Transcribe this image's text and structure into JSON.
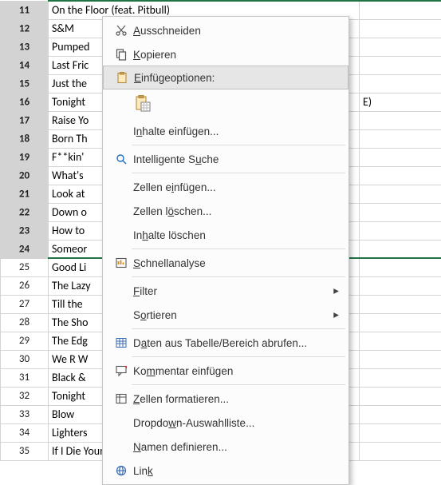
{
  "rows": [
    {
      "num": 11,
      "b": "On the Floor (feat. Pitbull)",
      "c": "",
      "sel": true
    },
    {
      "num": 12,
      "b": "S&M",
      "c": "",
      "sel": true
    },
    {
      "num": 13,
      "b": "Pumped",
      "c": "",
      "sel": true
    },
    {
      "num": 14,
      "b": "Last Fric",
      "c": "",
      "sel": true
    },
    {
      "num": 15,
      "b": "Just the",
      "c": "",
      "sel": true
    },
    {
      "num": 16,
      "b": "Tonight",
      "c": "E)",
      "sel": true
    },
    {
      "num": 17,
      "b": "Raise Yo",
      "c": "",
      "sel": true
    },
    {
      "num": 18,
      "b": "Born Th",
      "c": "",
      "sel": true
    },
    {
      "num": 19,
      "b": "F**kin' ",
      "c": "",
      "sel": true
    },
    {
      "num": 20,
      "b": "What's ",
      "c": "",
      "sel": true
    },
    {
      "num": 21,
      "b": "Look at",
      "c": "",
      "sel": true
    },
    {
      "num": 22,
      "b": "Down o",
      "c": "",
      "sel": true
    },
    {
      "num": 23,
      "b": "How to ",
      "c": "",
      "sel": true
    },
    {
      "num": 24,
      "b": "Someor",
      "c": "",
      "sel": true
    },
    {
      "num": 25,
      "b": "Good Li",
      "c": "",
      "sel": false
    },
    {
      "num": 26,
      "b": "The Lazy",
      "c": "",
      "sel": false
    },
    {
      "num": 27,
      "b": "Till the ",
      "c": "",
      "sel": false
    },
    {
      "num": 28,
      "b": "The Sho",
      "c": "",
      "sel": false
    },
    {
      "num": 29,
      "b": "The Edg",
      "c": "",
      "sel": false
    },
    {
      "num": 30,
      "b": "We R W",
      "c": "",
      "sel": false
    },
    {
      "num": 31,
      "b": "Black & ",
      "c": "",
      "sel": false
    },
    {
      "num": 32,
      "b": "Tonight",
      "c": "",
      "sel": false
    },
    {
      "num": 33,
      "b": "Blow",
      "c": "",
      "sel": false
    },
    {
      "num": 34,
      "b": "Lighters",
      "c": "",
      "sel": false
    },
    {
      "num": 35,
      "b": "If I Die Young",
      "c": "",
      "sel": false
    }
  ],
  "menu": {
    "cut": "Ausschneiden",
    "copy": "Kopieren",
    "pasteHeader": "Einfügeoptionen:",
    "pasteSpecial": "Inhalte einfügen...",
    "smartLookup": "Intelligente Suche",
    "insertCells": "Zellen einfügen...",
    "deleteCells": "Zellen löschen...",
    "clearContents": "Inhalte löschen",
    "quickAnalysis": "Schnellanalyse",
    "filter": "Filter",
    "sort": "Sortieren",
    "getData": "Daten aus Tabelle/Bereich abrufen...",
    "insertComment": "Kommentar einfügen",
    "formatCells": "Zellen formatieren...",
    "dropdown": "Dropdown-Auswahlliste...",
    "defineName": "Namen definieren...",
    "link": "Link"
  },
  "accel": {
    "cut": "A",
    "copy": "K",
    "pasteHeader": "E",
    "pasteSpecial": "n",
    "smartLookup": "u",
    "insertCells": "i",
    "deleteCells": "ö",
    "clearContents": "h",
    "quickAnalysis": "S",
    "filter": "F",
    "sort": "o",
    "getData": "a",
    "insertComment": "m",
    "formatCells": "Z",
    "dropdown": "w",
    "defineName": "N",
    "link": "k"
  },
  "icons": {
    "cut": "scissors-icon",
    "copy": "copy-icon",
    "paste": "clipboard-icon",
    "pasteOption": "paste-option-icon",
    "smartLookup": "search-sparkle-icon",
    "quickAnalysis": "quick-analysis-icon",
    "getData": "table-icon",
    "insertComment": "comment-icon",
    "formatCells": "format-cells-icon",
    "link": "link-icon"
  }
}
